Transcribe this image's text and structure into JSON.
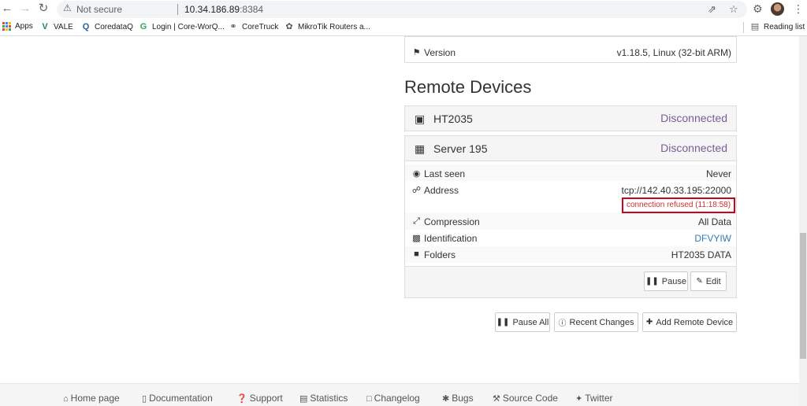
{
  "browser": {
    "security_label": "Not secure",
    "url_host": "10.34.186.89",
    "url_port": ":8384",
    "reading_list": "Reading list"
  },
  "bookmarks": [
    {
      "label": "Apps",
      "icon": "apps-grid-icon"
    },
    {
      "label": "VALE",
      "icon": "vale-icon"
    },
    {
      "label": "CoredataQ",
      "icon": "q-icon"
    },
    {
      "label": "Login | Core-WorQ...",
      "icon": "g-icon"
    },
    {
      "label": "CoreTruck",
      "icon": "globe-icon"
    },
    {
      "label": "MikroTik Routers a...",
      "icon": "mikrotik-icon"
    }
  ],
  "this_device": {
    "version_label": "Version",
    "version_value": "v1.18.5, Linux (32-bit ARM)"
  },
  "remote_devices": {
    "heading": "Remote Devices",
    "devices": [
      {
        "name": "HT2035",
        "status": "Disconnected"
      },
      {
        "name": "Server 195",
        "status": "Disconnected"
      }
    ],
    "details": {
      "last_seen_label": "Last seen",
      "last_seen_value": "Never",
      "address_label": "Address",
      "address_value": "tcp://142.40.33.195:22000",
      "address_error": "connection refused (11:18:58)",
      "compression_label": "Compression",
      "compression_value": "All Data",
      "identification_label": "Identification",
      "identification_value": "DFVYIW",
      "folders_label": "Folders",
      "folders_value": "HT2035 DATA"
    },
    "device_buttons": {
      "pause": "Pause",
      "edit": "Edit"
    },
    "actions": {
      "pause_all": "Pause All",
      "recent_changes": "Recent Changes",
      "add_remote": "Add Remote Device"
    }
  },
  "footer": {
    "links": [
      "Home page",
      "Documentation",
      "Support",
      "Statistics",
      "Changelog",
      "Bugs",
      "Source Code",
      "Twitter"
    ]
  },
  "colors": {
    "status_disconnected": "#7a5c99",
    "error_border": "#d0021b",
    "link": "#337ab7"
  }
}
